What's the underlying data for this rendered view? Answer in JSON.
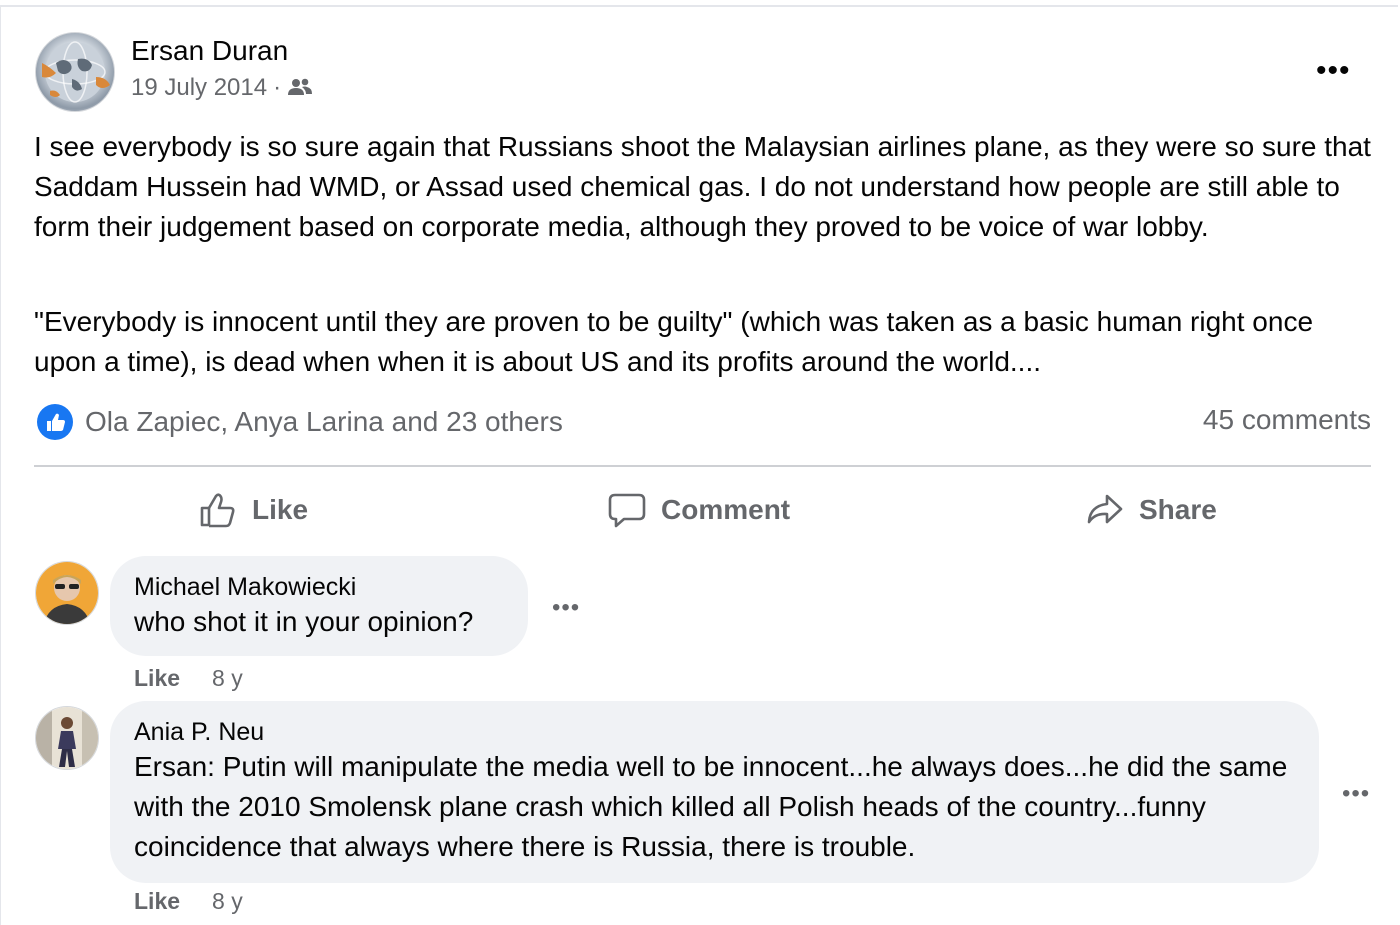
{
  "post": {
    "author": "Ersan Duran",
    "date": "19 July 2014",
    "separator": "·",
    "audience_icon": "friends-icon",
    "more_icon": "•••",
    "paragraphs": [
      "I see everybody is so sure again that Russians shoot the Malaysian airlines plane, as they were so sure that Saddam Hussein had WMD, or Assad used chemical gas. I do not understand how people are still able to form their judgement based on corporate media, although they proved to be voice of war lobby.",
      "\"Everybody is innocent until they are proven to be guilty\" (which was taken as a basic human right once upon a time), is dead when when it is about US and its profits around the world...."
    ],
    "reactions_text": "Ola Zapiec, Anya Larina and 23 others",
    "comments_count": "45 comments",
    "accent_color": "#1877f2"
  },
  "actions": {
    "like": "Like",
    "comment": "Comment",
    "share": "Share"
  },
  "comments": [
    {
      "name": "Michael Makowiecki",
      "text": "who shot it in your opinion?",
      "like": "Like",
      "time": "8 y",
      "more_icon": "•••"
    },
    {
      "name": "Ania P. Neu",
      "text": "Ersan: Putin will manipulate the media well to be innocent...he always does...he did the same with the 2010 Smolensk plane crash which killed all Polish heads of the country...funny coincidence that always where there is Russia, there is trouble.",
      "like": "Like",
      "time": "8 y",
      "more_icon": "•••"
    }
  ]
}
